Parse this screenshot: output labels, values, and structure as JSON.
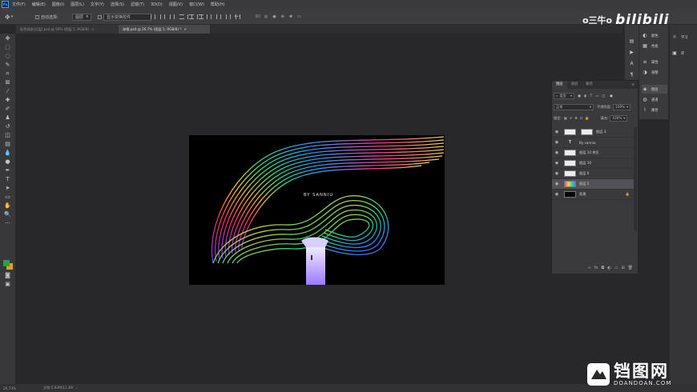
{
  "app": {
    "logo": "Ps"
  },
  "menu": [
    "文件(F)",
    "编辑(E)",
    "图像(I)",
    "图层(L)",
    "文字(Y)",
    "选择(S)",
    "滤镜(T)",
    "3D(D)",
    "视图(V)",
    "窗口(W)",
    "帮助(H)"
  ],
  "options_bar": {
    "auto_select_label": "自动选择:",
    "auto_select_target": "图层",
    "show_transform_label": "显示变换控件",
    "more": "•••"
  },
  "document_tabs": [
    {
      "label": "彩色线条(分层).psd @ 50% (图层 5, RGB/8)",
      "active": false
    },
    {
      "label": "海报.psd @ 26.7% (图层 5, RGB/8) *",
      "active": true
    }
  ],
  "canvas": {
    "byline": "BY SANNIU"
  },
  "layers_panel": {
    "tabs": [
      "图层",
      "通道",
      "路径"
    ],
    "filter_kind": "类型",
    "blend_mode": "正常",
    "opacity_label": "不透明度:",
    "opacity_value": "100%",
    "lock_label": "锁定:",
    "fill_label": "填充:",
    "fill_value": "100%",
    "layers": [
      {
        "name": "图层 3",
        "kind": "image",
        "selected": false
      },
      {
        "name": "By sanniu",
        "kind": "text",
        "selected": false
      },
      {
        "name": "图层 10 拷贝",
        "kind": "image",
        "selected": false
      },
      {
        "name": "图层 10",
        "kind": "image",
        "selected": false
      },
      {
        "name": "图层 6",
        "kind": "image",
        "selected": false
      },
      {
        "name": "图层 5",
        "kind": "image",
        "selected": true
      },
      {
        "name": "背景",
        "kind": "background",
        "selected": false
      }
    ]
  },
  "right_dock": {
    "group1": [
      "颜色",
      "色板"
    ],
    "group2": [
      "属性",
      "调整"
    ],
    "group3": [
      "图层",
      "通道",
      "路径"
    ],
    "group4": [
      "学习",
      "库"
    ]
  },
  "status": {
    "zoom": "26.73%",
    "doc_info": "文档:5.93M/11.3M"
  },
  "watermarks": {
    "top_name": "o三牛o",
    "top_logo": "bilibili",
    "bottom_cn": "铛图网",
    "bottom_en": "DOANDOAN.COM"
  },
  "colors": {
    "foreground": "#2aa04a",
    "background": "#e0a020",
    "selected_layer": "#525256"
  }
}
